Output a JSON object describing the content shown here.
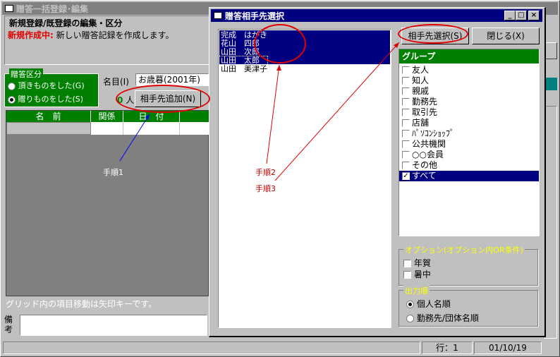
{
  "main_window": {
    "title": "贈答一括登録･編集",
    "section_title": "新規登録/既登録の編集・区分",
    "mode_label": "新規作成中:",
    "mode_desc": "新しい贈答記録を作成します。",
    "category_group": "贈答区分",
    "radio_received": "頂きものをした(G)",
    "radio_given": "贈りものをした(S)",
    "name_label": "名目(I)",
    "name_value": "お歳暮(2001年)",
    "count_value": "0",
    "count_unit": "人",
    "add_button": "相手先追加(N)",
    "grid_headers": [
      "名　前",
      "関係",
      "日　付"
    ],
    "grid_hint": "グリッド内の項目移動は矢印キーです。",
    "memo_label": "備考",
    "status_row": "行：1",
    "status_date": "01/10/19",
    "step1": "手順1"
  },
  "dialog": {
    "title": "贈答相手先選択",
    "select_button": "相手先選択(S)",
    "close_button": "閉じる(X)",
    "names": [
      "完成　はがき",
      "花山　四郎",
      "山田　次郎",
      "山田　太郎",
      "山田　美津子"
    ],
    "group_header": "グループ",
    "groups": [
      {
        "label": "友人",
        "checked": false
      },
      {
        "label": "知人",
        "checked": false
      },
      {
        "label": "親戚",
        "checked": false
      },
      {
        "label": "勤務先",
        "checked": false
      },
      {
        "label": "取引先",
        "checked": false
      },
      {
        "label": "店舗",
        "checked": false
      },
      {
        "label": "ﾊﾟｿｺﾝｼｮｯﾌﾟ",
        "checked": false
      },
      {
        "label": "公共機関",
        "checked": false
      },
      {
        "label": "○○会員",
        "checked": false
      },
      {
        "label": "その他",
        "checked": false
      },
      {
        "label": "すべて",
        "checked": true
      }
    ],
    "option_title": "オプション(オプション内OR条件)",
    "option_nenga": "年賀",
    "option_shochu": "暑中",
    "order_title": "出力順",
    "order_personal": "個人名順",
    "order_company": "勤務先/団体名順",
    "step2": "手順2",
    "step3": "手順3"
  }
}
